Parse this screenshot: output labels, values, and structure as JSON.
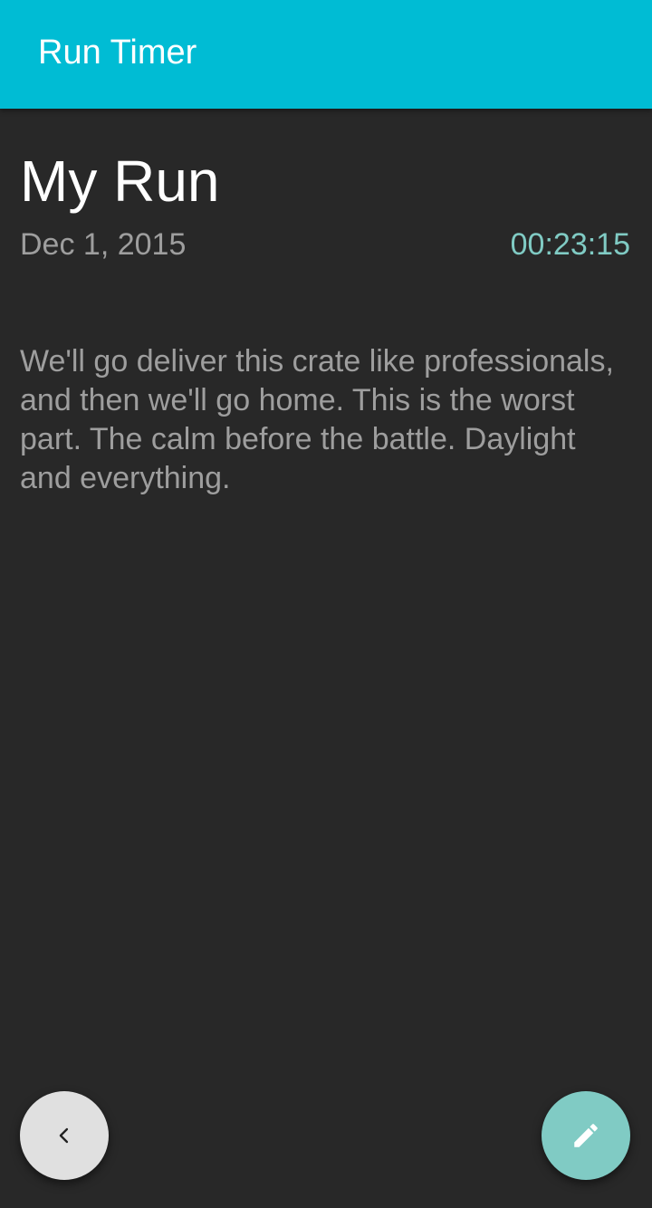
{
  "app_bar": {
    "title": "Run Timer",
    "color": "#00bcd4"
  },
  "run": {
    "title": "My Run",
    "date": "Dec 1, 2015",
    "duration": "00:23:15",
    "notes": "We'll go deliver this crate like professionals, and then we'll go home. This is the worst part. The calm before the battle. Daylight and everything."
  },
  "actions": {
    "back": {
      "icon": "chevron-left-icon",
      "color": "#e0e0e0"
    },
    "edit": {
      "icon": "pencil-icon",
      "color": "#80cbc4"
    }
  },
  "colors": {
    "background": "#282828",
    "accent": "#80cbc4"
  }
}
